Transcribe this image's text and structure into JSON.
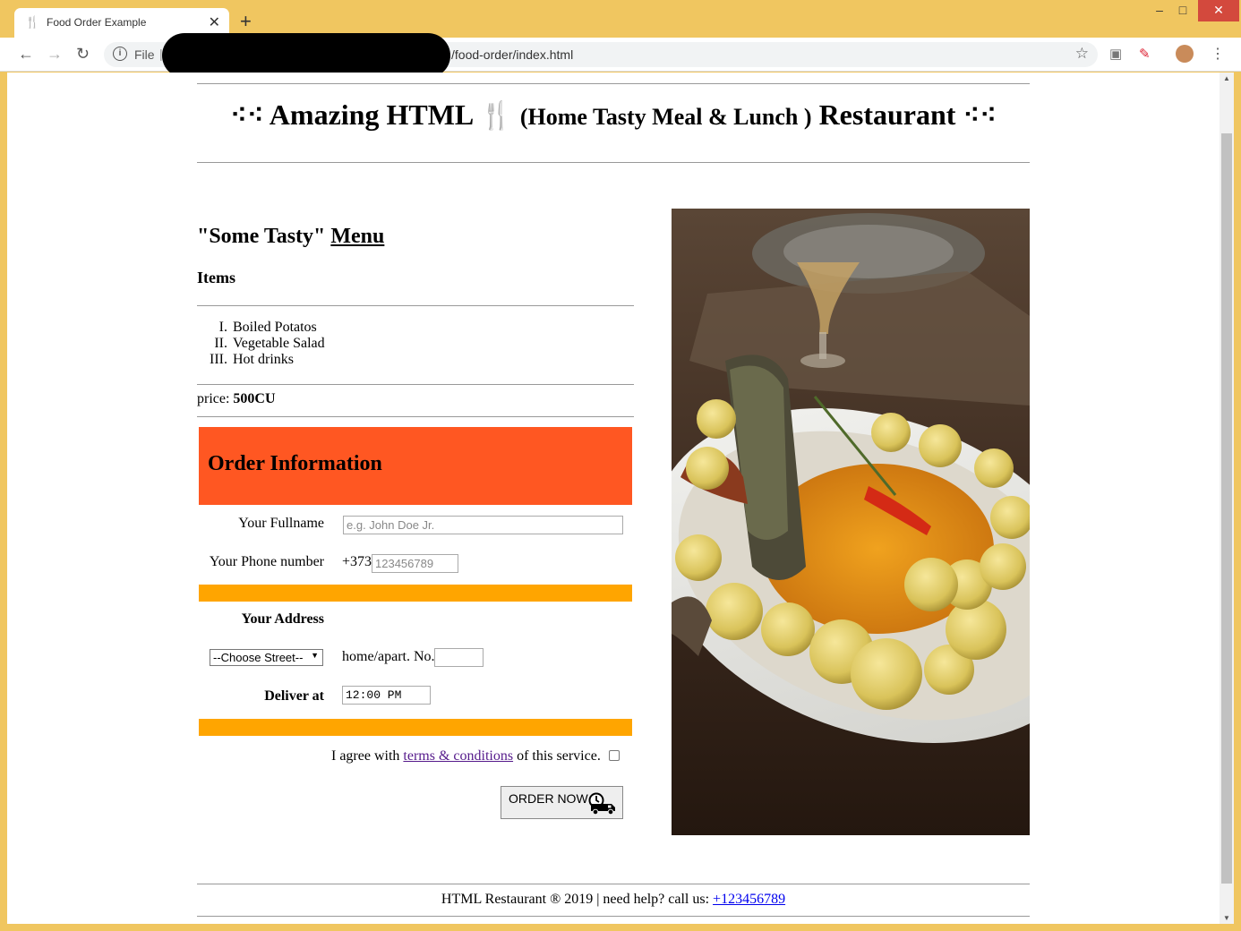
{
  "browser": {
    "tab_title": "Food Order Example",
    "tab_icon": "fork-knife-icon",
    "new_tab": "+",
    "file_label": "File",
    "url_visible": "/food-order/index.html"
  },
  "header": {
    "dots_left": "⁖⁖",
    "title_part1": "Amazing HTML",
    "fork_glyph": "🍴",
    "title_part2": "(Home Tasty Meal & Lunch )",
    "title_part3": "Restaurant",
    "dots_right": "⁖⁖"
  },
  "menu": {
    "heading_prefix": "\"Some Tasty\"",
    "heading_link": "Menu",
    "items_heading": "Items",
    "items": [
      {
        "num": "I.",
        "label": "Boiled Potatos"
      },
      {
        "num": "II.",
        "label": "Vegetable Salad"
      },
      {
        "num": "III.",
        "label": "Hot drinks"
      }
    ],
    "price_label": "price:",
    "price_value": "500CU"
  },
  "order": {
    "title": "Order Information",
    "fullname_label": "Your Fullname",
    "fullname_placeholder": "e.g. John Doe Jr.",
    "phone_label": "Your Phone number",
    "phone_prefix": "+373",
    "phone_placeholder": "123456789",
    "address_label": "Your Address",
    "street_select": "--Choose Street--",
    "home_label": "home/apart. No.",
    "deliver_label": "Deliver at",
    "deliver_time": "12:00 PM",
    "agree_prefix": "I agree with",
    "agree_link": "terms & conditions",
    "agree_suffix": "of this service.",
    "order_button": "ORDER NOW"
  },
  "footer": {
    "text": "HTML Restaurant ® 2019 | need help? call us:",
    "phone_link": "+123456789"
  },
  "colors": {
    "order_header": "#ff5722",
    "separator_bar": "#ffa500",
    "window_frame": "#f0c660"
  }
}
